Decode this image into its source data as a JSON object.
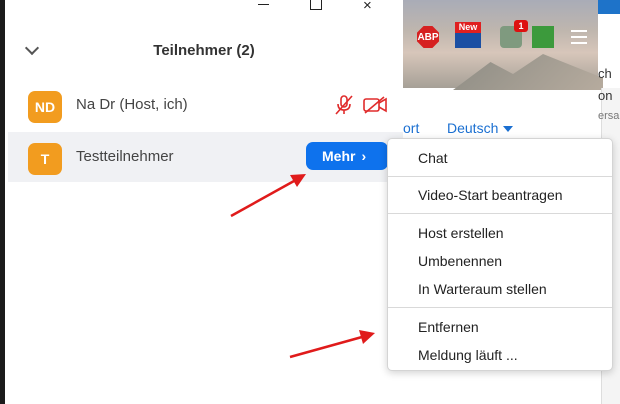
{
  "panel": {
    "title": "Teilnehmer (2)",
    "window_controls": {
      "min": "minimize",
      "max": "maximize",
      "close": "×"
    }
  },
  "participants": [
    {
      "initials": "ND",
      "name": "Na Dr (Host, ich)"
    },
    {
      "initials": "T",
      "name": "Testteilnehmer",
      "action_label": "Mehr",
      "action_chevron": "›"
    }
  ],
  "browser": {
    "language": "Deutsch",
    "port_fragment": "ort",
    "side_fragments": [
      "ch",
      "on",
      "ersa"
    ],
    "extensions": {
      "abp": "ABP",
      "new_label": "New",
      "badge_count": "1"
    }
  },
  "context_menu": {
    "items": [
      {
        "label": "Chat"
      },
      {
        "label": "Video-Start beantragen"
      },
      {
        "label": "Host erstellen"
      },
      {
        "label": "Umbenennen"
      },
      {
        "label": "In Warteraum stellen"
      },
      {
        "label": "Entfernen"
      },
      {
        "label": "Meldung läuft ..."
      }
    ]
  },
  "colors": {
    "avatar": "#f29c1f",
    "mehr_button": "#0e72ed",
    "arrow": "#e01b1b",
    "muted_icon": "#e02b2b"
  }
}
